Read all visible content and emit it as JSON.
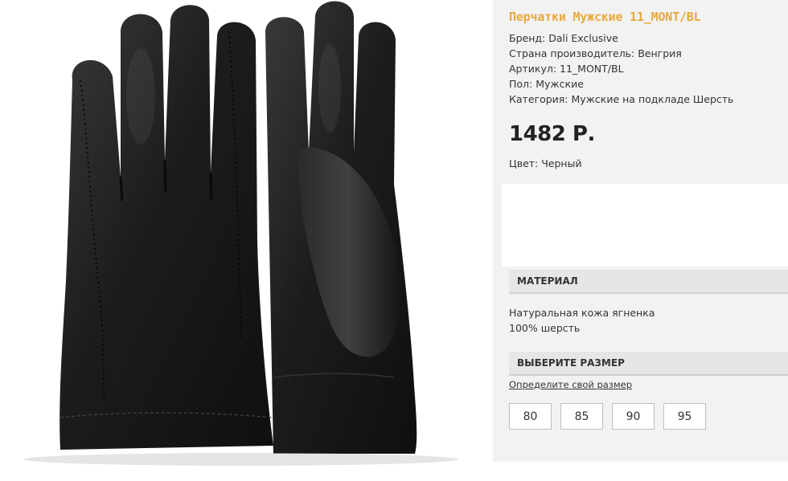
{
  "product": {
    "title": "Перчатки Мужские 11_MONT/BL",
    "specs": [
      "Бренд: Dali Exclusive",
      "Страна производитель: Венгрия",
      "Артикул: 11_MONT/BL",
      "Пол: Мужские",
      "Категория: Мужские на подкладе Шерсть"
    ],
    "price": "1482 Р.",
    "color": "Цвет: Черный"
  },
  "material": {
    "header": "МАТЕРИАЛ",
    "lines": [
      "Натуральная кожа ягненка",
      "100% шерсть"
    ]
  },
  "size": {
    "header": "ВЫБЕРИТЕ РАЗМЕР",
    "link": "Определите свой размер",
    "options": [
      "80",
      "85",
      "90",
      "95"
    ]
  },
  "colors": {
    "title": "#e8a83d",
    "panel": "#f2f2f2",
    "header_bg": "#e6e6e6",
    "glove": "#1a1a1a"
  },
  "icons": {
    "product_image": "black-leather-gloves-photo"
  }
}
